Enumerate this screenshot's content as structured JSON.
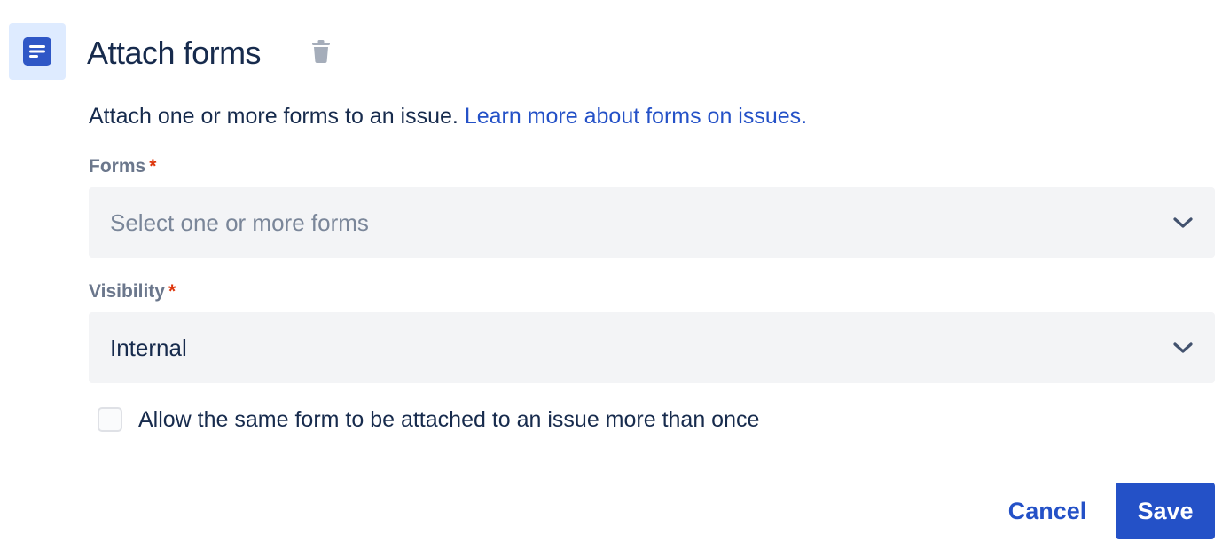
{
  "header": {
    "title": "Attach forms",
    "icon": "form-icon",
    "delete_icon": "trash-icon"
  },
  "description": {
    "text": "Attach one or more forms to an issue. ",
    "link": "Learn more about forms on issues."
  },
  "forms_field": {
    "label": "Forms",
    "required_marker": "*",
    "placeholder": "Select one or more forms",
    "value": ""
  },
  "visibility_field": {
    "label": "Visibility",
    "required_marker": "*",
    "value": "Internal"
  },
  "allow_multiple": {
    "label": "Allow the same form to be attached to an issue more than once",
    "checked": false
  },
  "actions": {
    "cancel_label": "Cancel",
    "save_label": "Save"
  },
  "colors": {
    "primary": "#2451c7",
    "required": "#de350b",
    "field_bg": "#f3f4f6",
    "icon_tile_bg": "#deebff"
  }
}
